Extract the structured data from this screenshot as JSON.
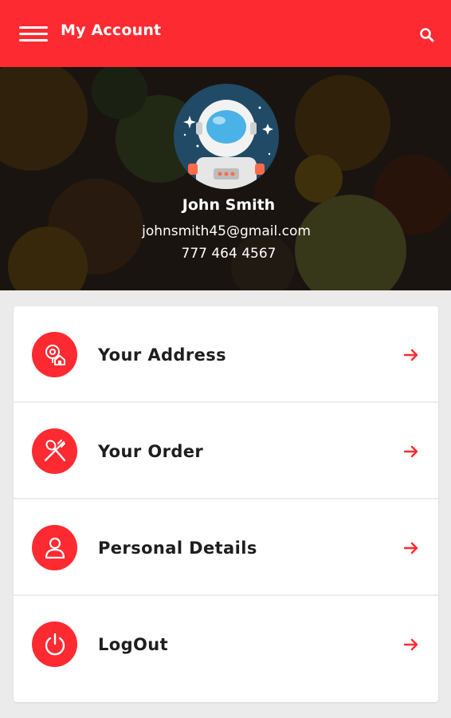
{
  "appbar": {
    "title": "My Account",
    "menu_icon": "hamburger-menu-icon",
    "search_icon": "search-icon",
    "color": "#fe2a31"
  },
  "profile": {
    "name": "John Smith",
    "email": "johnsmith45@gmail.com",
    "phone": "777 464 4567",
    "avatar": "astronaut-avatar"
  },
  "menu": {
    "items": [
      {
        "label": "Your Address",
        "icon": "location-home-icon"
      },
      {
        "label": "Your Order",
        "icon": "fork-spoon-icon"
      },
      {
        "label": "Personal Details",
        "icon": "user-icon"
      },
      {
        "label": "LogOut",
        "icon": "power-icon"
      }
    ],
    "arrow_icon": "arrow-right-icon",
    "accent": "#fe2a31"
  }
}
